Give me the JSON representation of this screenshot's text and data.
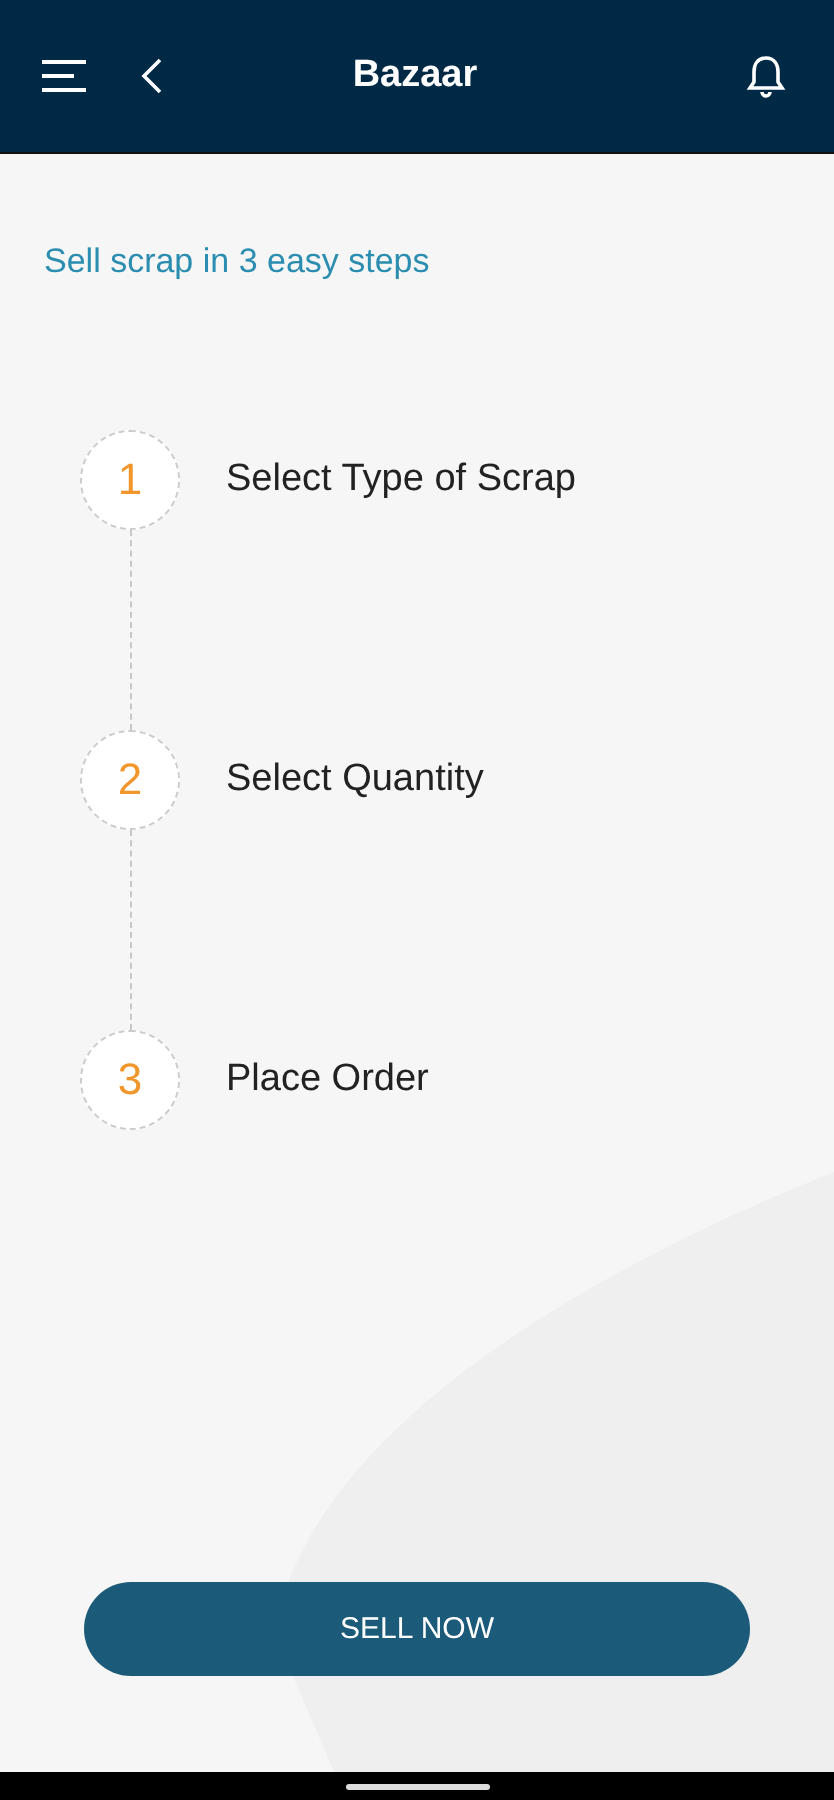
{
  "header": {
    "title": "Bazaar"
  },
  "subtitle": "Sell scrap in 3 easy steps",
  "steps": [
    {
      "number": "1",
      "label": "Select Type of Scrap"
    },
    {
      "number": "2",
      "label": "Select Quantity"
    },
    {
      "number": "3",
      "label": "Place Order"
    }
  ],
  "button": {
    "label": "SELL NOW"
  }
}
